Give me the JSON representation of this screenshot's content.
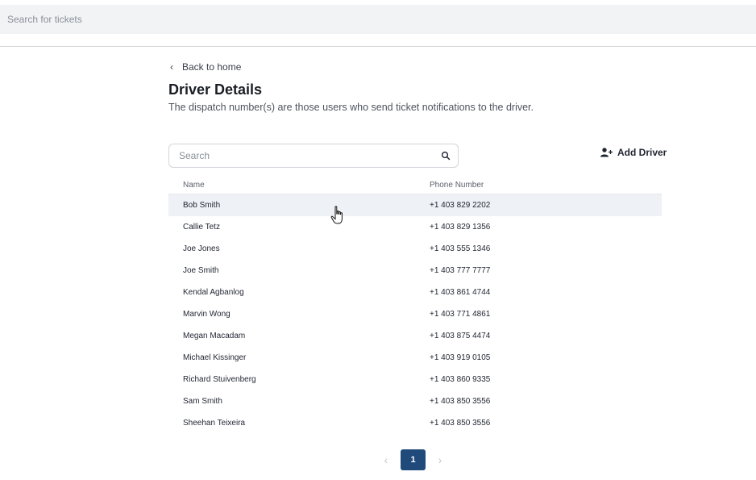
{
  "topbar": {
    "search_placeholder": "Search for tickets"
  },
  "nav": {
    "back_label": "Back to home"
  },
  "page": {
    "title": "Driver Details",
    "subtitle": "The dispatch number(s) are those users who send ticket notifications to the driver."
  },
  "search": {
    "placeholder": "Search"
  },
  "actions": {
    "add_driver_label": "Add Driver"
  },
  "table": {
    "columns": [
      "Name",
      "Phone Number"
    ],
    "rows": [
      {
        "name": "Bob Smith",
        "phone": "+1 403 829 2202"
      },
      {
        "name": "Callie Tetz",
        "phone": "+1 403 829 1356"
      },
      {
        "name": "Joe Jones",
        "phone": "+1 403 555 1346"
      },
      {
        "name": "Joe Smith",
        "phone": "+1 403 777 7777"
      },
      {
        "name": "Kendal Agbanlog",
        "phone": "+1 403 861 4744"
      },
      {
        "name": "Marvin Wong",
        "phone": "+1 403 771 4861"
      },
      {
        "name": "Megan Macadam",
        "phone": "+1 403 875 4474"
      },
      {
        "name": "Michael Kissinger",
        "phone": "+1 403 919 0105"
      },
      {
        "name": "Richard Stuivenberg",
        "phone": "+1 403 860 9335"
      },
      {
        "name": "Sam Smith",
        "phone": "+1 403 850 3556"
      },
      {
        "name": "Sheehan Teixeira",
        "phone": "+1 403 850 3556"
      }
    ]
  },
  "pagination": {
    "current_page": "1"
  },
  "colors": {
    "accent": "#1f4a7a",
    "row_hover": "#eef1f5",
    "topbar_bg": "#f2f3f5"
  }
}
